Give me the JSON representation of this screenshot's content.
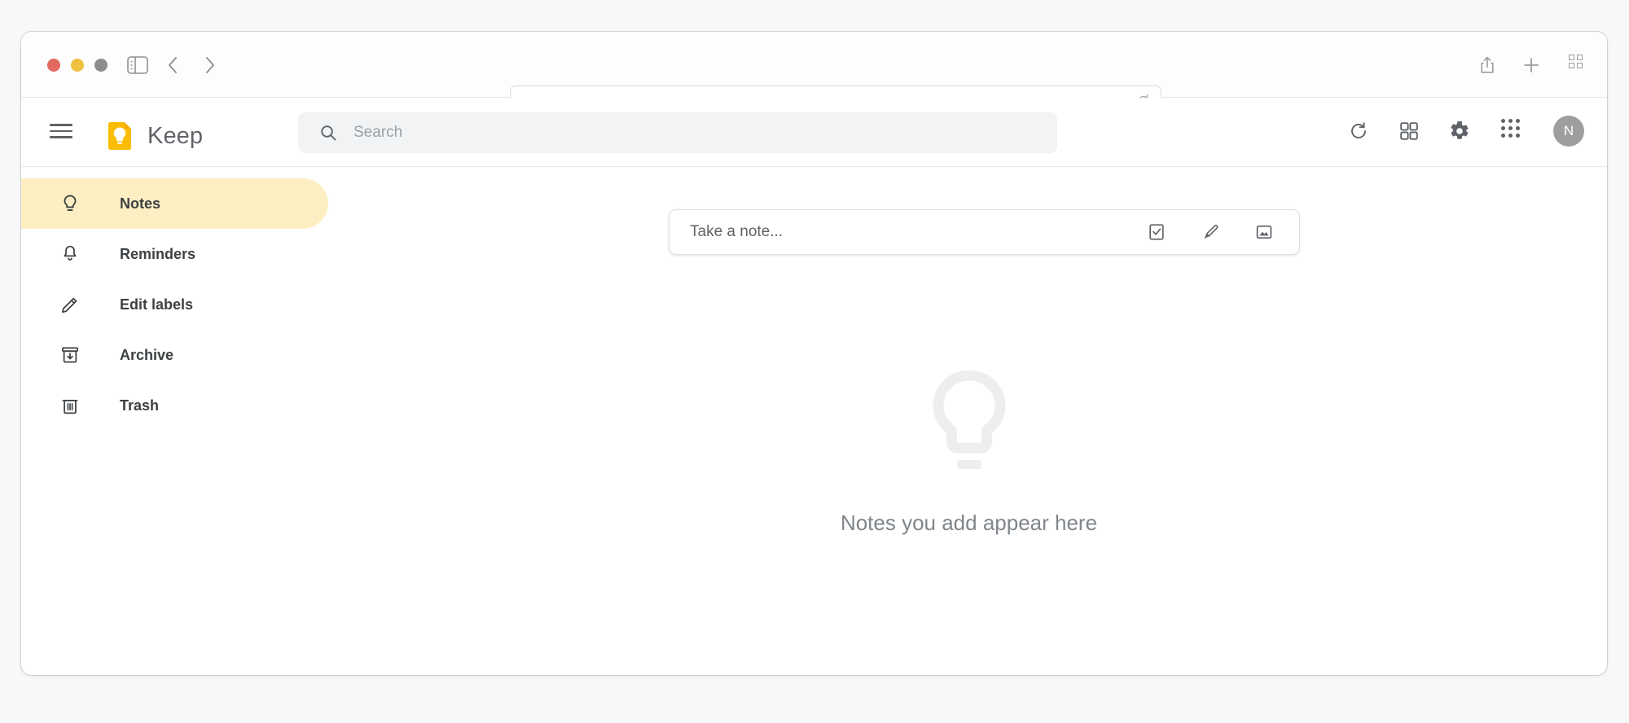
{
  "browser": {
    "window_controls": [
      {
        "name": "close",
        "color": "#e1695f"
      },
      {
        "name": "minimize",
        "color": "#f0c040"
      },
      {
        "name": "maximize",
        "color": "#8b8d8e"
      }
    ],
    "sidebar_toggle_icon": "sidebar-toggle-icon",
    "back_icon": "chevron-left-icon",
    "forward_icon": "chevron-forward-icon",
    "url_value": "",
    "url_placeholder": "",
    "reload_icon": "reload-icon",
    "share_icon": "share-icon",
    "new_tab_icon": "plus-icon",
    "tab_overview_icon": "tab-overview-icon"
  },
  "header": {
    "menu_icon": "hamburger-menu-icon",
    "logo_icon": "keep-logo-icon",
    "app_title": "Keep",
    "search": {
      "icon": "search-icon",
      "placeholder": "Search",
      "value": ""
    },
    "refresh_icon": "refresh-icon",
    "list_view_icon": "grid-view-toggle-icon",
    "settings_icon": "settings-gear-icon",
    "apps_icon": "google-apps-icon",
    "avatar_initial": "N",
    "avatar_color": "#9e9e9e"
  },
  "sidebar": {
    "items": [
      {
        "label": "Notes",
        "icon": "lightbulb-icon",
        "active": true
      },
      {
        "label": "Reminders",
        "icon": "bell-icon",
        "active": false
      },
      {
        "label": "Edit labels",
        "icon": "pencil-icon",
        "active": false
      },
      {
        "label": "Archive",
        "icon": "archive-icon",
        "active": false
      },
      {
        "label": "Trash",
        "icon": "trash-icon",
        "active": false
      }
    ],
    "active_color": "#feefc3"
  },
  "main": {
    "take_note_placeholder": "Take a note...",
    "new_list_icon": "checkbox-icon",
    "new_drawing_icon": "brush-icon",
    "new_image_icon": "image-icon",
    "empty_state_icon": "lightbulb-large-icon",
    "empty_state_text": "Notes you add appear here"
  },
  "colors": {
    "brand_yellow": "#fbbc04",
    "page_background": "#f7f8f8",
    "text_primary": "#3c4043",
    "text_secondary": "#5f6368",
    "text_muted": "#80868b"
  }
}
